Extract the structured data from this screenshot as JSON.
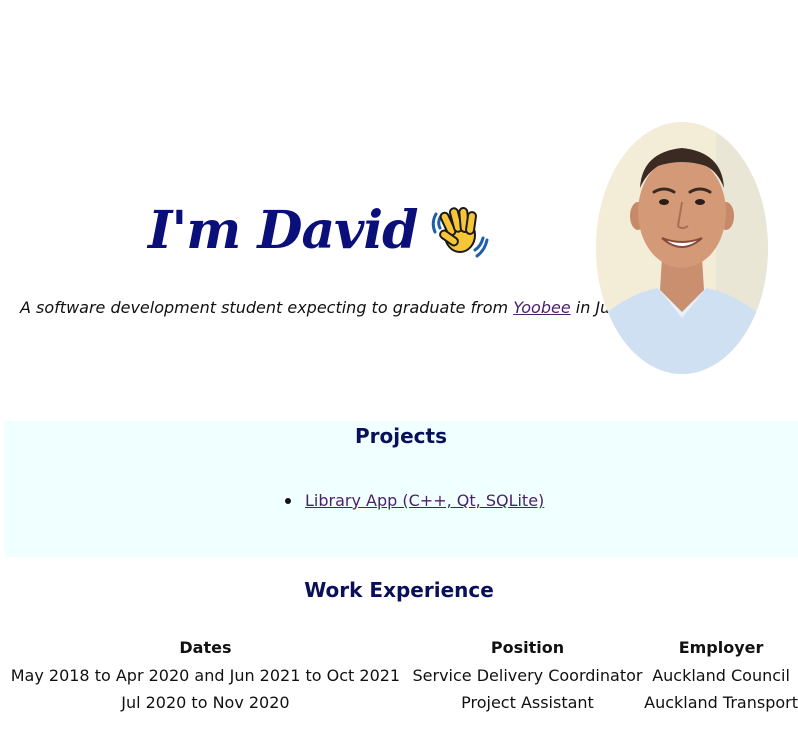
{
  "hero": {
    "title": "I'm David",
    "wave_emoji": "waving-hand",
    "subtitle_before": "A software development student expecting to graduate from ",
    "subtitle_link": "Yoobee",
    "subtitle_after": " in June 2023",
    "avatar_alt": "Portrait of David"
  },
  "projects": {
    "title": "Projects",
    "items": [
      {
        "label": "Library App (C++, Qt, SQLite)"
      }
    ]
  },
  "work": {
    "title": "Work Experience",
    "headers": {
      "dates": "Dates",
      "position": "Position",
      "employer": "Employer"
    },
    "rows": [
      {
        "dates": "May 2018 to Apr 2020 and Jun 2021 to Oct 2021",
        "position": "Service Delivery Coordinator",
        "employer": "Auckland Council"
      },
      {
        "dates": "Jul 2020 to Nov 2020",
        "position": "Project Assistant",
        "employer": "Auckland Transport"
      }
    ]
  },
  "colors": {
    "title": "#0a0f7a",
    "link": "#4a1f6b",
    "projects_bg": "#f0ffff"
  }
}
